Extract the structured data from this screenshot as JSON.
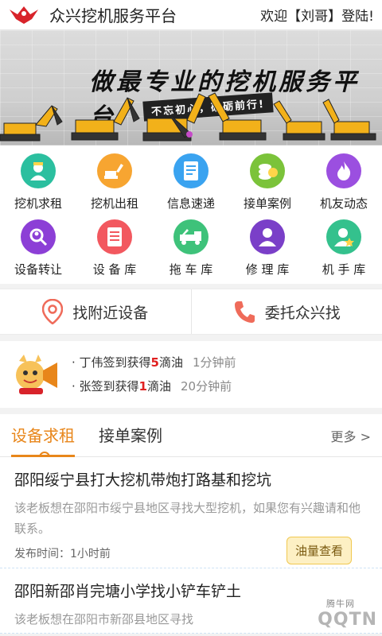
{
  "header": {
    "title": "众兴挖机服务平台",
    "welcome_prefix": "欢迎【",
    "user": "刘哥",
    "welcome_suffix": "】登陆!"
  },
  "banner": {
    "slogan": "做最专业的挖机服务平台",
    "sub_slogan": "不忘初心，砥砺前行!"
  },
  "menu": [
    {
      "label": "挖机求租",
      "icon": "worker-icon",
      "color": "#2bbf9f"
    },
    {
      "label": "挖机出租",
      "icon": "excavator-icon",
      "color": "#f7a531"
    },
    {
      "label": "信息速递",
      "icon": "document-icon",
      "color": "#3aa3f0"
    },
    {
      "label": "接单案例",
      "icon": "coins-icon",
      "color": "#7bc33a"
    },
    {
      "label": "机友动态",
      "icon": "flame-icon",
      "color": "#9b4fe0"
    },
    {
      "label": "设备转让",
      "icon": "search-person-icon",
      "color": "#8c3fd6"
    },
    {
      "label": "设 备 库",
      "icon": "list-icon",
      "color": "#f2585f"
    },
    {
      "label": "拖 车 库",
      "icon": "tow-truck-icon",
      "color": "#3ec27a"
    },
    {
      "label": "修 理 库",
      "icon": "mechanic-icon",
      "color": "#7a3fc8"
    },
    {
      "label": "机 手 库",
      "icon": "operator-icon",
      "color": "#34c18d"
    }
  ],
  "quick": {
    "nearby": "找附近设备",
    "entrust": "委托众兴找"
  },
  "news": [
    {
      "prefix": "· 丁伟签到获得",
      "num": "5",
      "suffix": "滴油",
      "time": "1分钟前"
    },
    {
      "prefix": "· 张签到获得",
      "num": "1",
      "suffix": "滴油",
      "time": "20分钟前"
    }
  ],
  "tabs": {
    "tab1": "设备求租",
    "tab2": "接单案例",
    "more": "更多 >"
  },
  "listings": [
    {
      "title": "邵阳绥宁县打大挖机带炮打路基和挖坑",
      "desc": "该老板想在邵阳市绥宁县地区寻找大型挖机，如果您有兴趣请和他联系。",
      "meta": "发布时间：1小时前",
      "action": "油量查看"
    },
    {
      "title": "邵阳新邵肖完塘小学找小铲车铲土",
      "desc": "该老板想在邵阳市新邵县地区寻找",
      "meta": "",
      "action": ""
    }
  ],
  "watermark": {
    "main": "QQTN",
    "small": "腾牛网"
  }
}
